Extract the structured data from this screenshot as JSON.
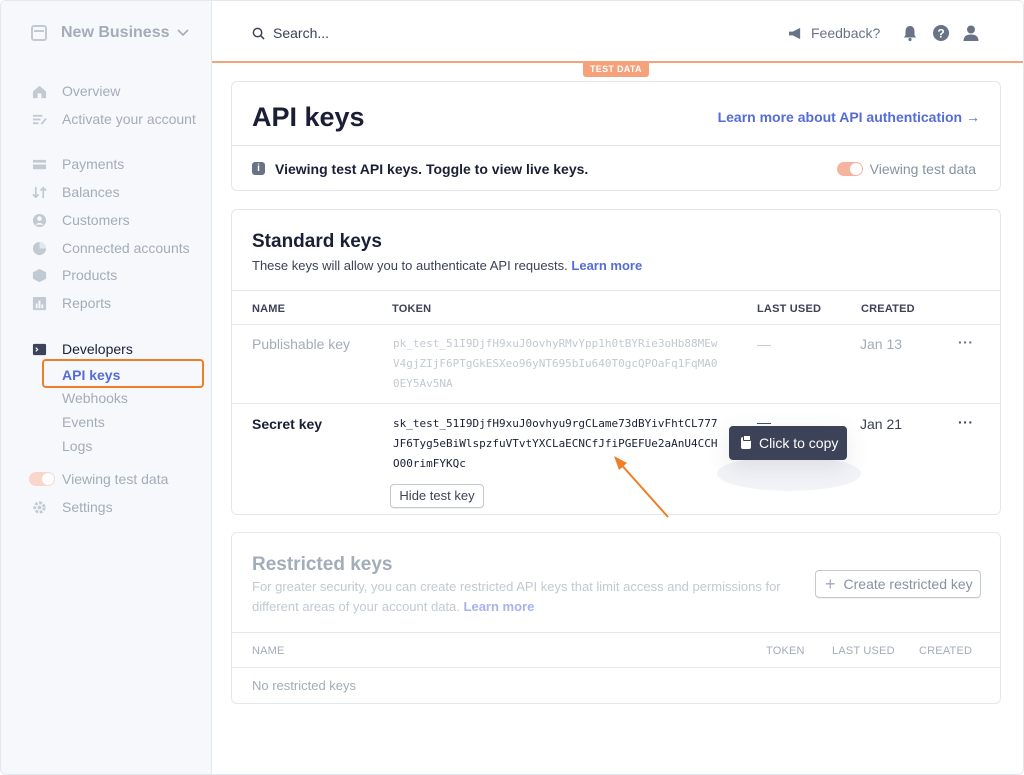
{
  "sidebar": {
    "account": "New Business",
    "items": [
      {
        "label": "Overview"
      },
      {
        "label": "Activate your account"
      },
      {
        "label": "Payments"
      },
      {
        "label": "Balances"
      },
      {
        "label": "Customers"
      },
      {
        "label": "Connected accounts"
      },
      {
        "label": "Products"
      },
      {
        "label": "Reports"
      }
    ],
    "developers": "Developers",
    "dev_items": [
      "API keys",
      "Webhooks",
      "Events",
      "Logs"
    ],
    "toggle_label": "Viewing test data",
    "settings": "Settings"
  },
  "topbar": {
    "search_placeholder": "Search...",
    "feedback": "Feedback?",
    "test_badge": "TEST DATA"
  },
  "header": {
    "title": "API keys",
    "learn_link": "Learn more about API authentication →",
    "info_text": "Viewing test API keys. Toggle to view live keys.",
    "toggle_label": "Viewing test data"
  },
  "standard": {
    "title": "Standard keys",
    "subtitle": "These keys will allow you to authenticate API requests.",
    "learn_more": "Learn more",
    "columns": [
      "NAME",
      "TOKEN",
      "LAST USED",
      "CREATED"
    ],
    "rows": [
      {
        "name": "Publishable key",
        "token": "pk_test_51I9DjfH9xuJ0ovhyRMvYpp1h0tBYRie3oHb88MEwV4gjZIjF6PTgGkESXeo96yNT695bIu640T0gcQPOaFq1FqMA00EY5Av5NA",
        "last_used": "—",
        "created": "Jan 13",
        "more": "···"
      },
      {
        "name": "Secret key",
        "token": "sk_test_51I9DjfH9xuJ0ovhyu9rgCLame73dBYivFhtCL777JF6Tyg5eBiWlspzfuVTvtYXCLaECNCfJfiPGEFUe2aAnU4CCHO00rimFYKQc",
        "last_used": "—",
        "created": "Jan 21",
        "more": "···",
        "hide_button": "Hide test key"
      }
    ],
    "tooltip": "Click to copy"
  },
  "restricted": {
    "title": "Restricted keys",
    "subtitle": "For greater security, you can create restricted API keys that limit access and permissions for different areas of your account data.",
    "learn_more": "Learn more",
    "create_button": "Create restricted key",
    "columns": [
      "NAME",
      "TOKEN",
      "LAST USED",
      "CREATED"
    ],
    "empty": "No restricted keys"
  },
  "colors": {
    "accent": "#556cd6",
    "highlight": "#f07e29",
    "test_data": "#f5a179"
  }
}
